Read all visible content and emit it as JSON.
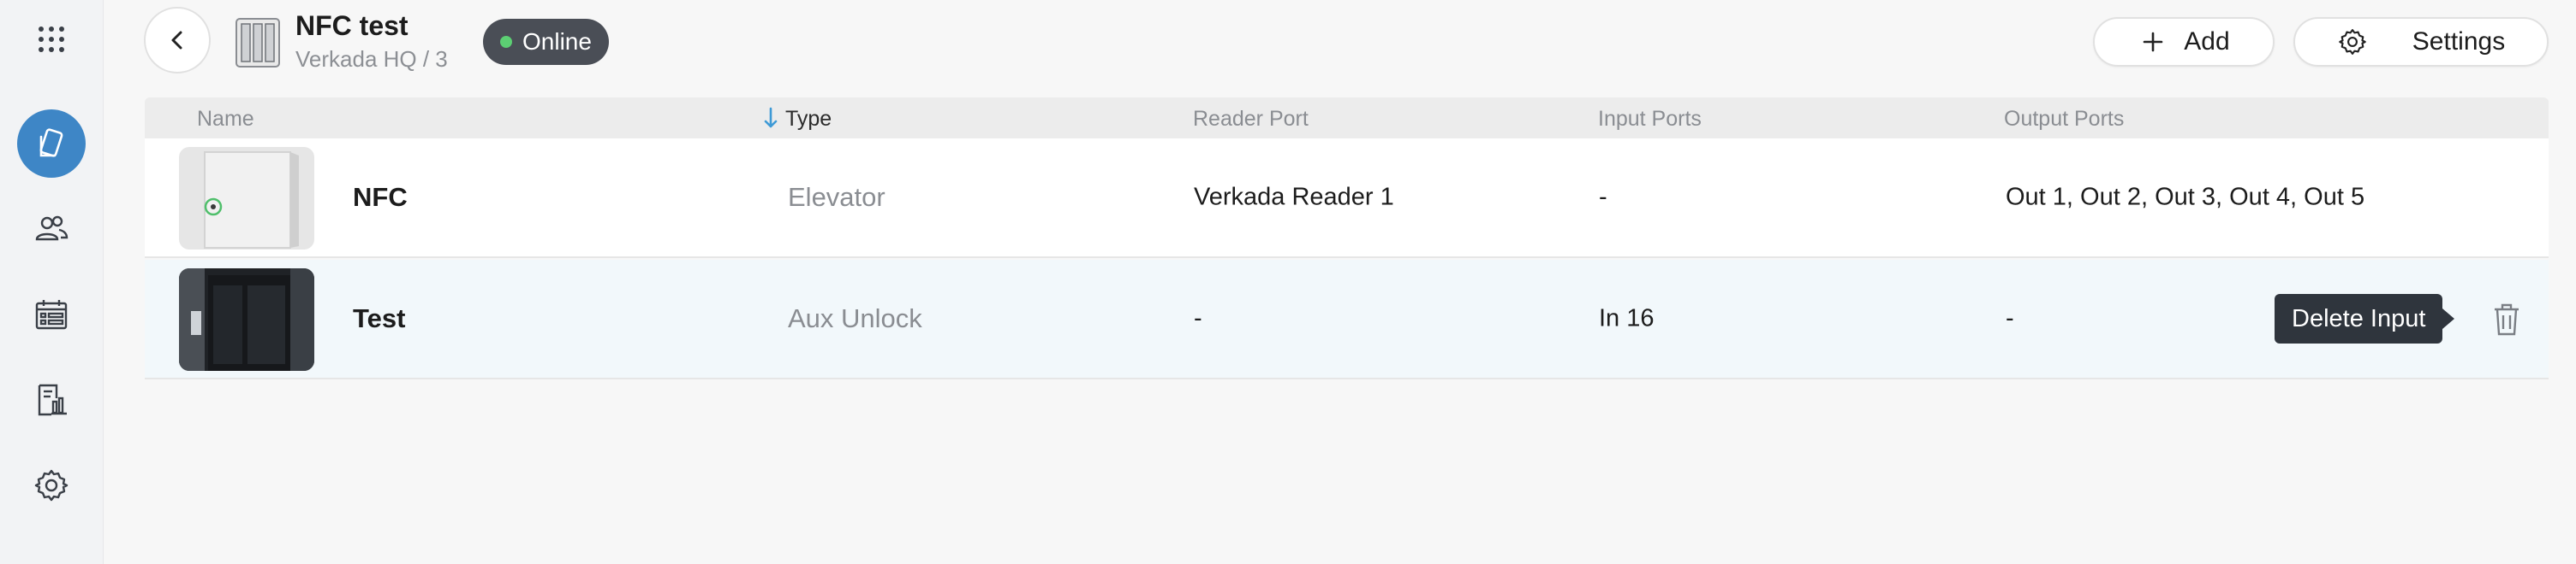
{
  "header": {
    "title": "NFC test",
    "subtitle": "Verkada HQ / 3",
    "status": "Online",
    "add_label": "Add",
    "settings_label": "Settings"
  },
  "sidebar": {
    "items": [
      {
        "icon": "apps-grid-icon"
      },
      {
        "icon": "access-card-icon",
        "active": true
      },
      {
        "icon": "users-icon"
      },
      {
        "icon": "calendar-icon"
      },
      {
        "icon": "reports-icon"
      },
      {
        "icon": "gear-icon"
      }
    ]
  },
  "table": {
    "columns": [
      "Name",
      "Type",
      "Reader Port",
      "Input Ports",
      "Output Ports"
    ],
    "sorted_column": "Type",
    "rows": [
      {
        "name": "NFC",
        "type": "Elevator",
        "reader_port": "Verkada Reader 1",
        "input_ports": "-",
        "output_ports": "Out 1, Out 2, Out 3, Out 4, Out 5"
      },
      {
        "name": "Test",
        "type": "Aux Unlock",
        "reader_port": "-",
        "input_ports": "In 16",
        "output_ports": "-"
      }
    ]
  },
  "tooltip": "Delete Input",
  "colors": {
    "accent": "#3e86c6",
    "status_online": "#5ccf73",
    "badge_bg": "#4a4e56",
    "selected_row_bg": "#f2f8fb"
  }
}
